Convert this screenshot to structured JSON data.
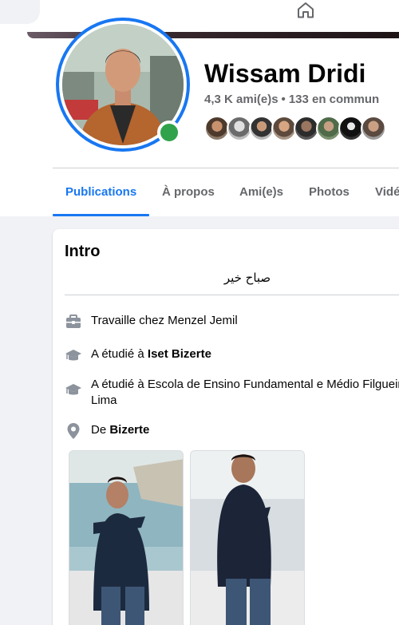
{
  "nav": {
    "home_icon": "home-icon"
  },
  "profile": {
    "name": "Wissam Dridi",
    "friends_count": "4,3 K ami(e)s",
    "separator": "•",
    "mutual_count": "133 en commun",
    "online": true
  },
  "tabs": [
    {
      "label": "Publications",
      "active": true
    },
    {
      "label": "À propos"
    },
    {
      "label": "Ami(e)s"
    },
    {
      "label": "Photos"
    },
    {
      "label": "Vidé"
    }
  ],
  "intro": {
    "title": "Intro",
    "bio": "صباح خير",
    "work": {
      "prefix": "Travaille chez ",
      "value": "Menzel Jemil",
      "icon": "briefcase-icon"
    },
    "education_1": {
      "prefix": "A étudié à ",
      "value": "Iset Bizerte",
      "icon": "graduation-cap-icon"
    },
    "education_2": {
      "prefix": "A étudié à ",
      "value": "Escola de Ensino Fundamental e Médio Filgueira Lima",
      "icon": "graduation-cap-icon"
    },
    "hometown": {
      "prefix": "De ",
      "value": "Bizerte",
      "icon": "location-pin-icon"
    }
  },
  "colors": {
    "accent": "#1877f2",
    "online": "#31a24c",
    "secondary_text": "#65676b"
  }
}
